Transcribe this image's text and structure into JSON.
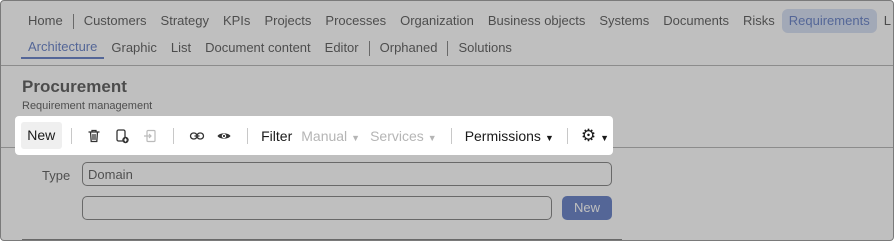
{
  "nav": {
    "primary": [
      "Home",
      "Customers",
      "Strategy",
      "KPIs",
      "Projects",
      "Processes",
      "Organization",
      "Business objects",
      "Systems",
      "Documents",
      "Risks",
      "Requirements",
      "L"
    ],
    "secondary": [
      "Architecture",
      "Graphic",
      "List",
      "Document content",
      "Editor",
      "Orphaned",
      "Solutions"
    ]
  },
  "page": {
    "title": "Procurement",
    "subtitle": "Requirement management"
  },
  "toolbar": {
    "new_label": "New",
    "filter_label": "Filter",
    "manual_label": "Manual",
    "services_label": "Services",
    "permissions_label": "Permissions"
  },
  "form": {
    "type_label": "Type",
    "type_value": "Domain",
    "new_button_label": "New"
  },
  "colors": {
    "accent": "#2a4fb0",
    "active_tab_bg": "#c6d3ef",
    "overlay": "#7f7f7f"
  }
}
